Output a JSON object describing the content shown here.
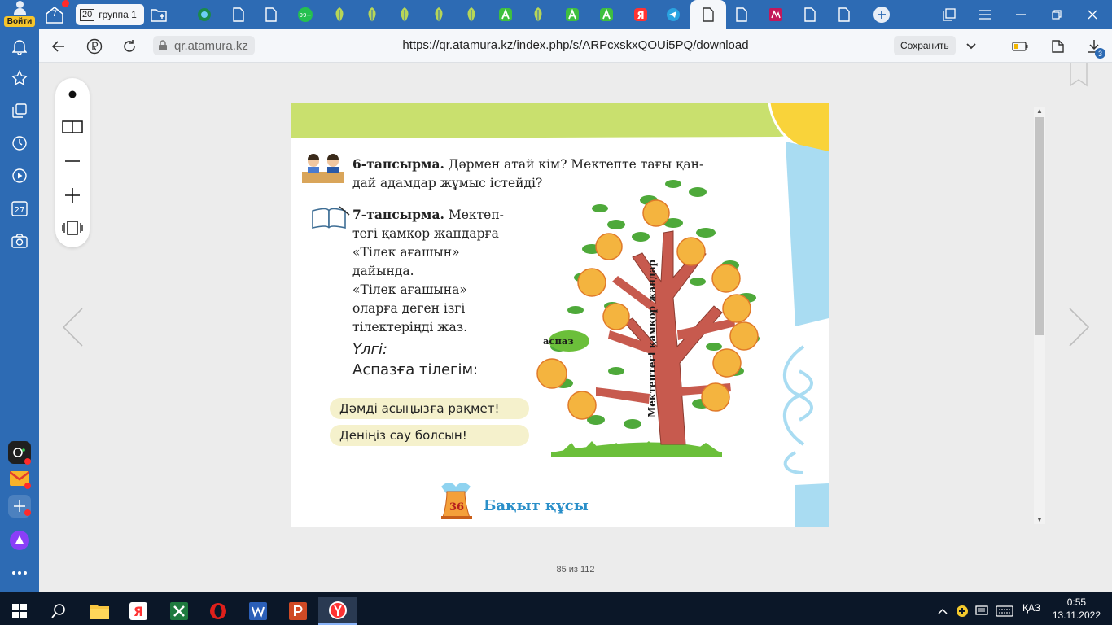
{
  "account": {
    "login_label": "Войти"
  },
  "tabs": {
    "counter_value": "7",
    "group_number": "20",
    "group_label": "группа 1",
    "badge_99": "99+",
    "yandex_letter": "Я"
  },
  "addressbar": {
    "domain": "qr.atamura.kz",
    "url": "https://qr.atamura.kz/index.php/s/ARPcxskxQOUi5PQ/download",
    "save_label": "Сохранить",
    "downloads_count": "3"
  },
  "sidebar": {
    "calendar_day": "27"
  },
  "viewer": {
    "page_status": "85 из 112"
  },
  "page": {
    "task6_title": "6-тапсырма.",
    "task6_line1": " Дәрмен атай кім? Мектепте тағы қан-",
    "task6_line2": "дай адамдар жұмыс істейді?",
    "task7_title": "7-тапсырма.",
    "task7_line1": " Мектеп-",
    "task7_line2": "тегі қамқор жандарға",
    "task7_line3": "«Тілек ағашын»",
    "task7_line4": "дайында.",
    "task7_line5": "«Тілек ағашына»",
    "task7_line6": "оларға деген ізгі",
    "task7_line7": "тілектеріңді жаз.",
    "sample_label": "Үлгі:",
    "sample_heading": "Аспазға тілегім:",
    "wish1": "Дәмді асыңызға рақмет!",
    "wish2": "Деніңіз сау болсын!",
    "tree_leaf_label": "аспаз",
    "tree_trunk_label": "Мектептегі қамқор жандар",
    "bell_number": "36",
    "footer_title": "Бақыт құсы"
  },
  "taskbar": {
    "language": "ҚАЗ",
    "time": "0:55",
    "date": "13.11.2022"
  },
  "colors": {
    "browser_blue": "#2d6bb4",
    "page_green": "#c9e06e",
    "page_sky": "#a9dcf2",
    "sun_yellow": "#f9d33a",
    "wish_pill": "#f5f1cc",
    "footer_blue": "#2a8fc9"
  }
}
